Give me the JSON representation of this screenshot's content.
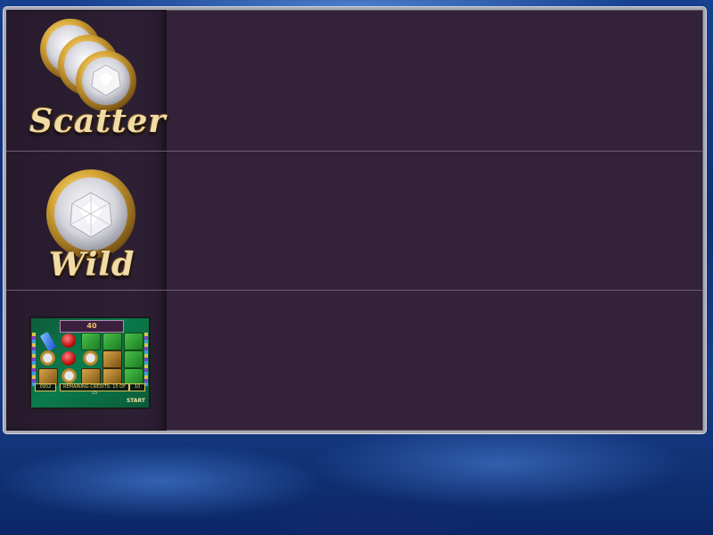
{
  "paytable": {
    "scatter": {
      "label": "Scatter",
      "icon": "diamond-coin-stack-icon"
    },
    "wild": {
      "label": "Wild",
      "icon": "diamond-coin-icon"
    },
    "preview": {
      "bet_display": "40",
      "bottom_left_value": "0952",
      "bottom_center_text": "REMAINING CREDITS: 15 OF 15",
      "bottom_right_value": "10",
      "start_label": "START"
    }
  }
}
